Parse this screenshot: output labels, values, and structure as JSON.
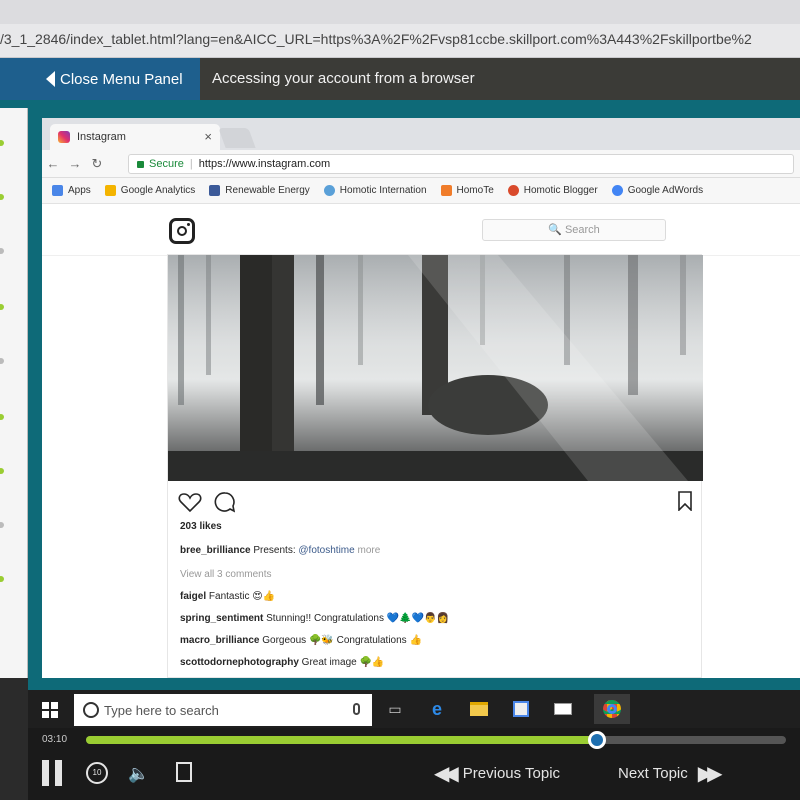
{
  "browser": {
    "address_url": "/3_1_2846/index_tablet.html?lang=en&AICC_URL=https%3A%2F%2Fvsp81ccbe.skillport.com%3A443%2Fskillportbe%2"
  },
  "header": {
    "close_menu_label": "Close Menu Panel",
    "topic_title": "Accessing your account from a browser"
  },
  "inner_browser": {
    "tab_title": "Instagram",
    "tab_close": "×",
    "secure_label": "Secure",
    "url": "https://www.instagram.com",
    "nav": {
      "back": "←",
      "forward": "→",
      "reload": "↻"
    },
    "bookmarks": [
      {
        "label": "Apps",
        "color": "#4a86e8"
      },
      {
        "label": "Google Analytics",
        "color": "#f4b400"
      },
      {
        "label": "Renewable Energy",
        "color": "#3c5a99"
      },
      {
        "label": "Homotic Internation",
        "color": "#5aa0d8"
      },
      {
        "label": "HomoTe",
        "color": "#f07c2a"
      },
      {
        "label": "Homotic Blogger",
        "color": "#d94a2b"
      },
      {
        "label": "Google AdWords",
        "color": "#4285f4"
      }
    ]
  },
  "instagram": {
    "search_placeholder": "🔍 Search",
    "likes": "203 likes",
    "caption": {
      "user": "bree_brilliance",
      "text": "Presents: ",
      "mention": "@fotoshtime",
      "more": "more"
    },
    "view_all": "View all 3 comments",
    "comments": [
      {
        "user": "faigel",
        "text": "Fantastic 😍👍"
      },
      {
        "user": "spring_sentiment",
        "text": "Stunning!! Congratulations 💙🌲💙👨👩"
      },
      {
        "user": "macro_brilliance",
        "text": "Gorgeous 🌳🐝 Congratulations 👍"
      },
      {
        "user": "scottodornephotography",
        "text": "Great image 🌳👍"
      }
    ]
  },
  "taskbar": {
    "search_placeholder": "Type here to search"
  },
  "player": {
    "time": "03:10",
    "progress": 0.73,
    "replay_label": "10",
    "previous_label": "Previous Topic",
    "next_label": "Next Topic"
  }
}
